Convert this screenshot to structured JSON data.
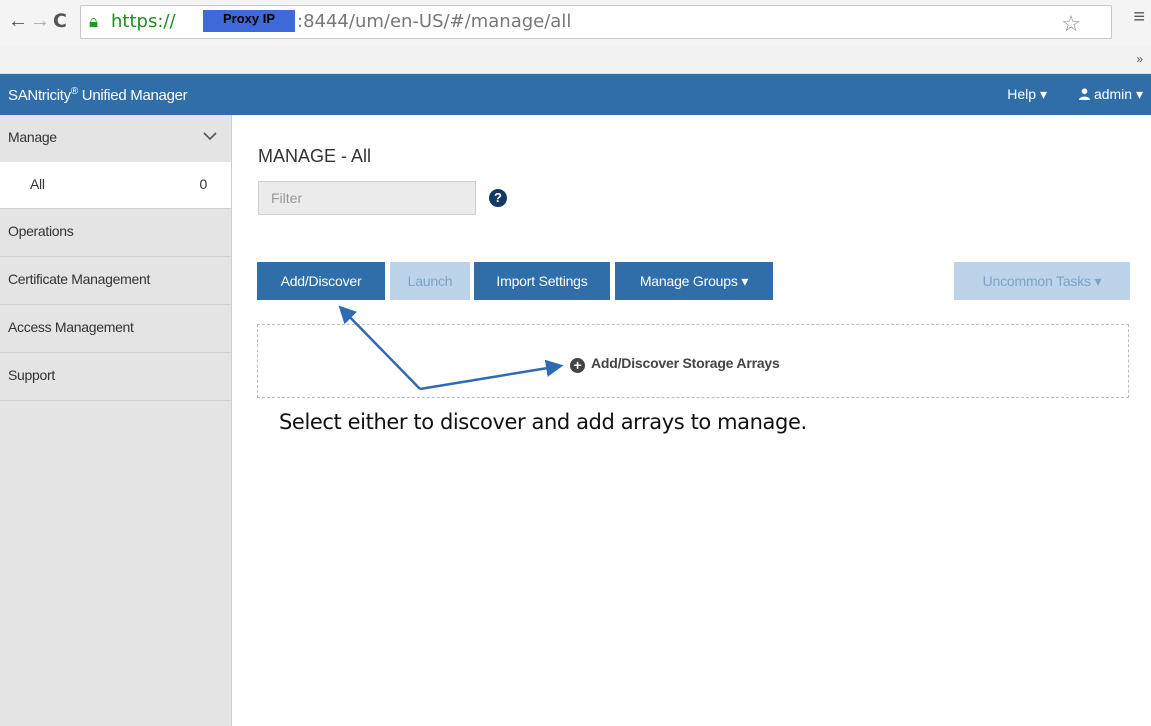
{
  "browser": {
    "url_scheme": "https://",
    "redaction_label": "Proxy IP",
    "url_rest": ":8444/um/en-US/#/manage/all",
    "bookmarks_more": "»"
  },
  "header": {
    "app_name": "SANtricity",
    "registered_mark": "®",
    "app_suffix": " Unified Manager",
    "help_label": "Help ▾",
    "admin_label": "admin ▾",
    "accent_color": "#2f6ea8"
  },
  "sidebar": {
    "manage": "Manage",
    "all": "All",
    "all_count": "0",
    "items": [
      "Operations",
      "Certificate Management",
      "Access Management",
      "Support"
    ]
  },
  "main": {
    "title": "MANAGE - All",
    "filter_placeholder": "Filter",
    "help_icon": "?",
    "toolbar": {
      "add_discover": "Add/Discover",
      "launch": "Launch",
      "import_settings": "Import Settings",
      "manage_groups": "Manage Groups ▾",
      "uncommon_tasks": "Uncommon Tasks ▾"
    },
    "add_link": "Add/Discover Storage Arrays"
  },
  "annotation": {
    "text": "Select either to discover and add arrays to manage.",
    "arrow_color": "#2f6ab4"
  },
  "icons": {
    "back": "arrow-left-icon",
    "forward": "arrow-right-icon",
    "reload": "reload-icon",
    "lock": "lock-icon",
    "star": "star-icon",
    "menu": "hamburger-menu-icon",
    "chevron": "chevron-down-icon",
    "user": "user-icon",
    "help": "question-circle-icon",
    "plus": "plus-circle-icon"
  }
}
